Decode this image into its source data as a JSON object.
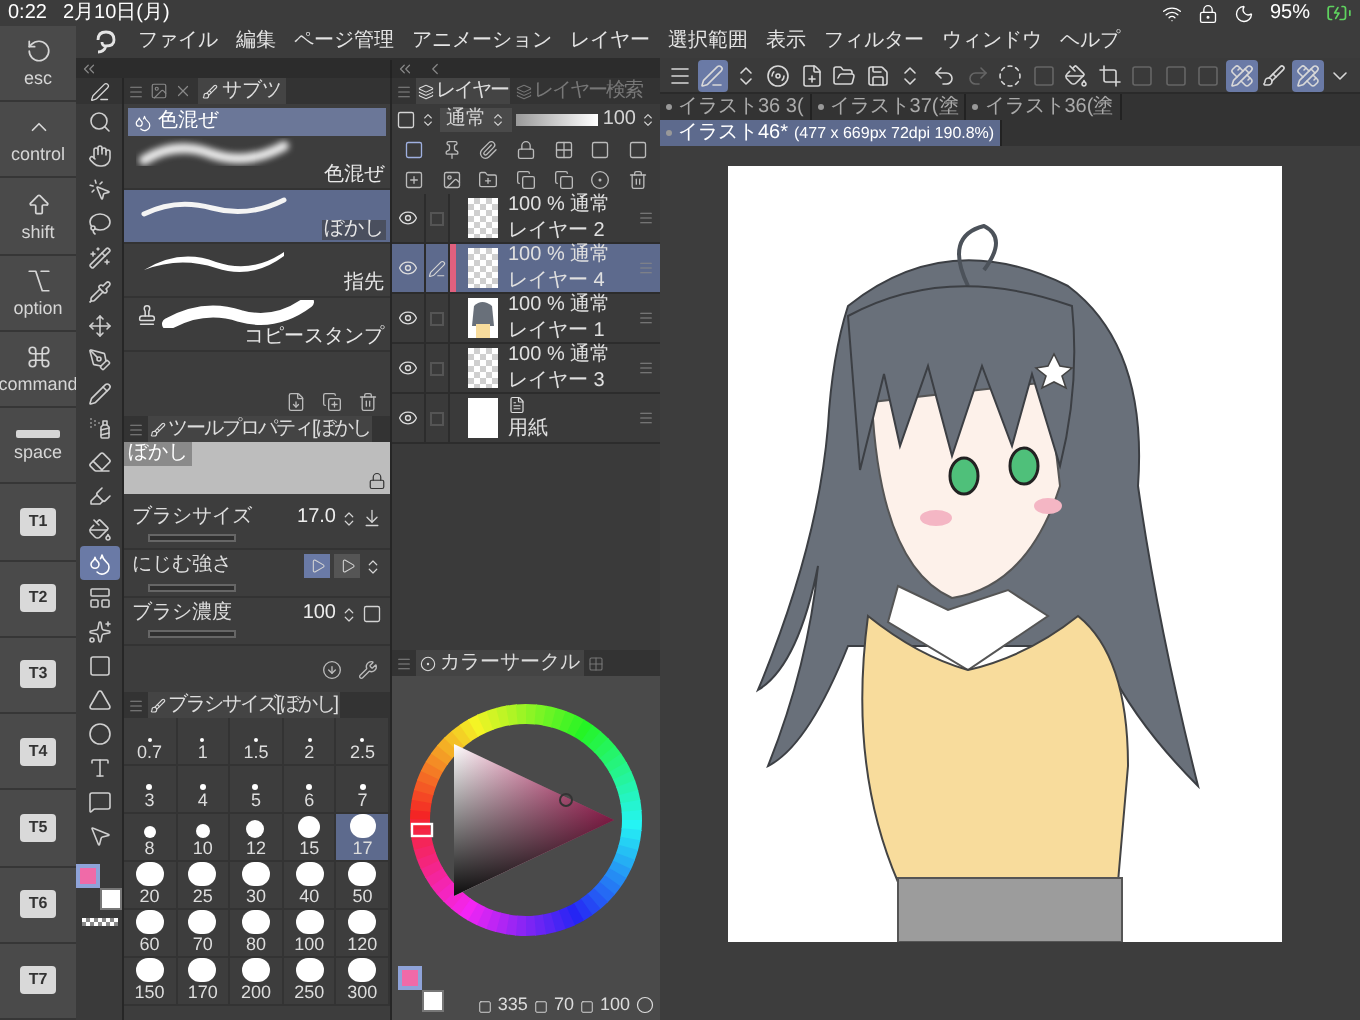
{
  "status_bar": {
    "time": "0:22",
    "date": "2月10日(月)",
    "battery": "95%"
  },
  "keys": [
    {
      "kind": "esc",
      "label": "esc"
    },
    {
      "kind": "control",
      "label": "control"
    },
    {
      "kind": "shift",
      "label": "shift"
    },
    {
      "kind": "option",
      "label": "option"
    },
    {
      "kind": "command",
      "label": "command"
    },
    {
      "kind": "space",
      "label": "space"
    },
    {
      "kind": "custom",
      "label": "T1"
    },
    {
      "kind": "custom",
      "label": "T2"
    },
    {
      "kind": "custom",
      "label": "T3"
    },
    {
      "kind": "custom",
      "label": "T4"
    },
    {
      "kind": "custom",
      "label": "T5"
    },
    {
      "kind": "custom",
      "label": "T6"
    },
    {
      "kind": "custom",
      "label": "T7"
    }
  ],
  "menu": [
    "ファイル",
    "編集",
    "ページ管理",
    "アニメーション",
    "レイヤー",
    "選択範囲",
    "表示",
    "フィルター",
    "ウィンドウ",
    "ヘルプ"
  ],
  "toolbar": [
    {
      "kind": "menu",
      "selected": false,
      "disabled": false
    },
    {
      "kind": "pen",
      "selected": true,
      "disabled": false
    },
    {
      "kind": "updown",
      "selected": false,
      "disabled": false
    },
    {
      "kind": "spiral",
      "selected": false,
      "disabled": false
    },
    {
      "kind": "new",
      "selected": false,
      "disabled": false
    },
    {
      "kind": "open",
      "selected": false,
      "disabled": false
    },
    {
      "kind": "save",
      "selected": false,
      "disabled": false
    },
    {
      "kind": "updown",
      "selected": false,
      "disabled": false
    },
    {
      "kind": "undo",
      "selected": false,
      "disabled": false
    },
    {
      "kind": "redo",
      "selected": false,
      "disabled": true
    },
    {
      "kind": "deselect",
      "selected": false,
      "disabled": false
    },
    {
      "kind": "square",
      "selected": false,
      "disabled": true
    },
    {
      "kind": "fill",
      "selected": false,
      "disabled": false
    },
    {
      "kind": "crop",
      "selected": false,
      "disabled": false
    },
    {
      "kind": "square",
      "selected": false,
      "disabled": true
    },
    {
      "kind": "square",
      "selected": false,
      "disabled": true
    },
    {
      "kind": "square",
      "selected": false,
      "disabled": true
    },
    {
      "kind": "ruler",
      "selected": true,
      "disabled": false
    },
    {
      "kind": "brush",
      "selected": false,
      "disabled": false
    },
    {
      "kind": "ruler",
      "selected": true,
      "disabled": false
    },
    {
      "kind": "more",
      "selected": false,
      "disabled": false
    }
  ],
  "tabs": [
    {
      "label": "イラスト36 3(",
      "selected": false
    },
    {
      "label": "イラスト37(塗",
      "selected": false
    },
    {
      "label": "イラスト36(塗",
      "selected": false
    },
    {
      "label": "イラスト46*",
      "info": "(477 x 669px 72dpi 190.8%)",
      "selected": true
    }
  ],
  "tools": [
    {
      "kind": "zoom",
      "selected": false
    },
    {
      "kind": "hand",
      "selected": false
    },
    {
      "kind": "object",
      "selected": false
    },
    {
      "kind": "lasso",
      "selected": false
    },
    {
      "kind": "wand",
      "selected": false
    },
    {
      "kind": "eyedropper",
      "selected": false
    },
    {
      "kind": "move",
      "selected": false
    },
    {
      "kind": "pen",
      "selected": false
    },
    {
      "kind": "pencil",
      "selected": false
    },
    {
      "kind": "airbrush",
      "selected": false
    },
    {
      "kind": "eraser",
      "selected": false
    },
    {
      "kind": "decoration",
      "selected": false
    },
    {
      "kind": "fill",
      "selected": false
    },
    {
      "kind": "blend",
      "selected": true
    },
    {
      "kind": "frame",
      "selected": false
    },
    {
      "kind": "correct",
      "selected": false
    },
    {
      "kind": "gradient",
      "selected": false
    },
    {
      "kind": "figure",
      "selected": false
    },
    {
      "kind": "circle",
      "selected": false
    },
    {
      "kind": "text",
      "selected": false
    },
    {
      "kind": "balloon",
      "selected": false
    },
    {
      "kind": "operation",
      "selected": false
    }
  ],
  "tool_swatches": [
    {
      "color": "#f06aa8",
      "selected": true
    },
    {
      "color": "#ffffff",
      "selected": false
    }
  ],
  "sub_tool": {
    "tab": "サブツ",
    "group": "色混ぜ",
    "brushes": [
      {
        "name": "色混ぜ",
        "kind": "soft",
        "selected": false
      },
      {
        "name": "ぼかし",
        "kind": "blur",
        "selected": true
      },
      {
        "name": "指先",
        "kind": "finger",
        "selected": false
      },
      {
        "name": "コピースタンプ",
        "kind": "stamp",
        "selected": false
      }
    ]
  },
  "tool_property": {
    "title": "ツールプロパティ[ぼかし",
    "preview": "ぼかし",
    "rows": [
      {
        "kind": "size",
        "label": "ブラシサイズ",
        "value": "17.0"
      },
      {
        "kind": "toggle",
        "label": "にじむ強さ",
        "options": [
          {
            "selected": true
          },
          {
            "selected": false
          }
        ]
      },
      {
        "kind": "density",
        "label": "ブラシ濃度",
        "value": "100"
      }
    ]
  },
  "brush_size": {
    "title": "ブラシサイズ[ぼかし]",
    "sizes": [
      {
        "label": "0.7",
        "selected": false
      },
      {
        "label": "1",
        "selected": false
      },
      {
        "label": "1.5",
        "selected": false
      },
      {
        "label": "2",
        "selected": false
      },
      {
        "label": "2.5",
        "selected": false
      },
      {
        "label": "3",
        "selected": false
      },
      {
        "label": "4",
        "selected": false
      },
      {
        "label": "5",
        "selected": false
      },
      {
        "label": "6",
        "selected": false
      },
      {
        "label": "7",
        "selected": false
      },
      {
        "label": "8",
        "selected": false
      },
      {
        "label": "10",
        "selected": false
      },
      {
        "label": "12",
        "selected": false
      },
      {
        "label": "15",
        "selected": false
      },
      {
        "label": "17",
        "selected": true
      },
      {
        "label": "20",
        "selected": false
      },
      {
        "label": "25",
        "selected": false
      },
      {
        "label": "30",
        "selected": false
      },
      {
        "label": "40",
        "selected": false
      },
      {
        "label": "50",
        "selected": false
      },
      {
        "label": "60",
        "selected": false
      },
      {
        "label": "70",
        "selected": false
      },
      {
        "label": "80",
        "selected": false
      },
      {
        "label": "100",
        "selected": false
      },
      {
        "label": "120",
        "selected": false
      },
      {
        "label": "150",
        "selected": false
      },
      {
        "label": "170",
        "selected": false
      },
      {
        "label": "200",
        "selected": false
      },
      {
        "label": "250",
        "selected": false
      },
      {
        "label": "300",
        "selected": false
      }
    ]
  },
  "layers": {
    "tabs": [
      {
        "label": "レイヤー",
        "selected": true
      },
      {
        "label": "レイヤー検索",
        "selected": false
      }
    ],
    "blend": "通常",
    "opacity": "100",
    "opacity_slider": {
      "level": 1
    },
    "items": [
      {
        "info": "100 % 通常",
        "name": "レイヤー 2",
        "kind": "raster",
        "visible": true,
        "selected": false
      },
      {
        "info": "100 % 通常",
        "name": "レイヤー 4",
        "kind": "raster",
        "visible": true,
        "selected": true
      },
      {
        "info": "100 % 通常",
        "name": "レイヤー 1",
        "kind": "image",
        "visible": true,
        "selected": false
      },
      {
        "info": "100 % 通常",
        "name": "レイヤー 3",
        "kind": "raster",
        "visible": true,
        "selected": false
      },
      {
        "name": "用紙",
        "kind": "paper",
        "visible": true,
        "selected": false
      }
    ]
  },
  "color_circle": {
    "title": "カラーサークル",
    "hue": "335",
    "saturation": "70",
    "value": "100",
    "swatches": [
      {
        "color": "#f06aa8",
        "selected": true
      },
      {
        "color": "#ffffff",
        "selected": false
      }
    ]
  }
}
